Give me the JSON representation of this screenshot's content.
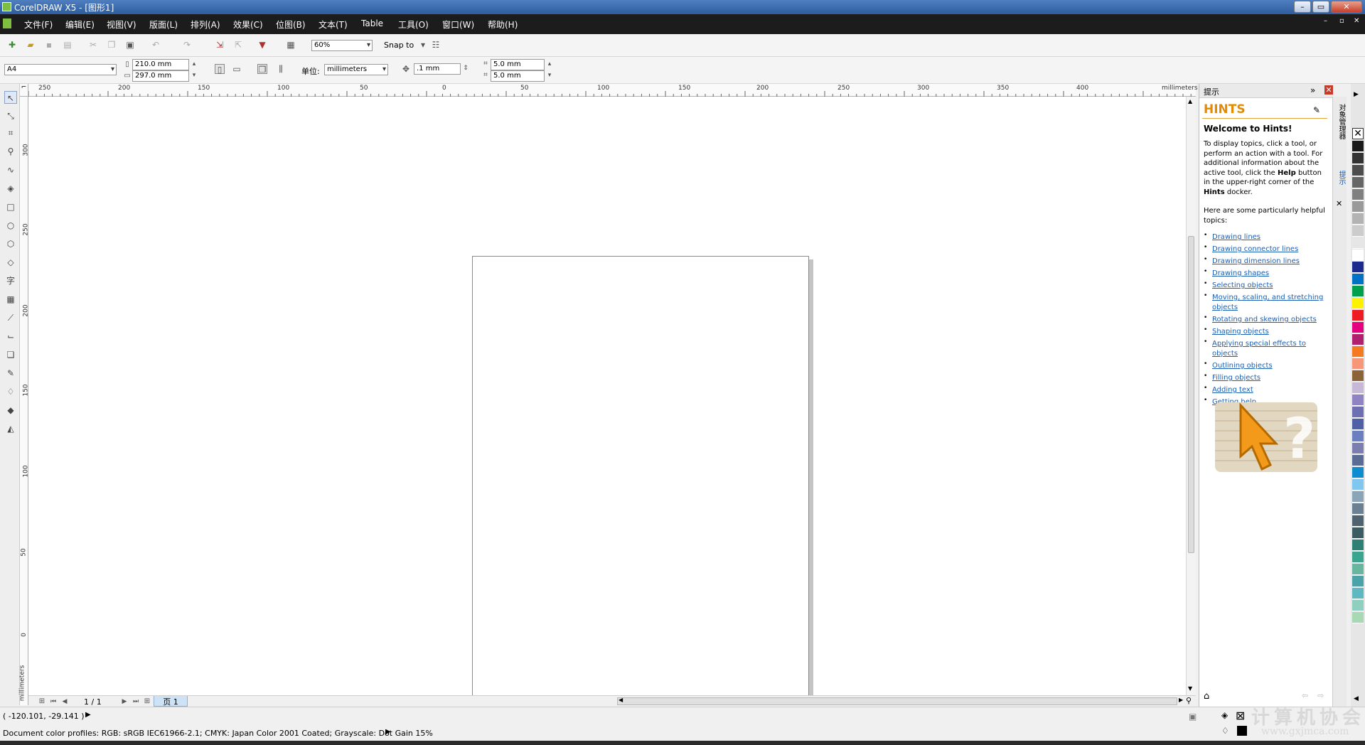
{
  "window": {
    "title": "CorelDRAW X5 - [图形1]",
    "controls": {
      "minimize": "–",
      "restore": "▭",
      "close": "✕"
    }
  },
  "menu": [
    "文件(F)",
    "编辑(E)",
    "视图(V)",
    "版面(L)",
    "排列(A)",
    "效果(C)",
    "位图(B)",
    "文本(T)",
    "Table",
    "工具(O)",
    "窗口(W)",
    "帮助(H)"
  ],
  "standard_toolbar": {
    "zoom_value": "60%",
    "snap_label": "Snap to"
  },
  "property_bar": {
    "paper_size": "A4",
    "width": "210.0 mm",
    "height": "297.0 mm",
    "units_label": "单位:",
    "units_value": "millimeters",
    "nudge": ".1 mm",
    "dup_x": "5.0 mm",
    "dup_y": "5.0 mm"
  },
  "ruler": {
    "unit": "millimeters",
    "h_ticks": [
      "250",
      "200",
      "150",
      "100",
      "50",
      "0",
      "50",
      "100",
      "150",
      "200",
      "250",
      "300",
      "350",
      "400"
    ],
    "v_ticks": [
      "300",
      "250",
      "200",
      "150",
      "100",
      "50",
      "0"
    ],
    "v_unit": "millimeters"
  },
  "page_nav": {
    "counter": "1 / 1",
    "tab_label": "页 1"
  },
  "docker": {
    "panel_title": "提示",
    "heading": "HINTS",
    "welcome": "Welcome to Hints!",
    "intro_1": "To display topics, click a tool, or perform an action with a tool. For additional information about the active tool, click the",
    "intro_help": "Help",
    "intro_2": "button in the upper-right corner of the",
    "intro_hints": "Hints",
    "intro_3": "docker.",
    "helpful": "Here are some particularly helpful topics:",
    "links": [
      "Drawing lines",
      "Drawing connector lines",
      "Drawing dimension lines",
      "Drawing shapes",
      "Selecting objects",
      "Moving, scaling, and stretching objects",
      "Rotating and skewing objects",
      "Shaping objects",
      "Applying special effects to objects",
      "Outlining objects",
      "Filling objects",
      "Adding text",
      "Getting help"
    ]
  },
  "docker_tabs": [
    "对象管理器",
    "提示"
  ],
  "palette_colors": [
    "#1a1a1a",
    "#333333",
    "#4d4d4d",
    "#666666",
    "#808080",
    "#999999",
    "#b3b3b3",
    "#cccccc",
    "#e6e6e6",
    "#ffffff",
    "#1b2a8c",
    "#0072c6",
    "#00a04a",
    "#fff200",
    "#ed1c24",
    "#e4007f",
    "#b0206e",
    "#f47920",
    "#f7977a",
    "#8c6239",
    "#c7b8d8",
    "#8f83c4",
    "#6d6fb3",
    "#4f5fa8",
    "#6a7fc0",
    "#7c7eb0",
    "#5b6c94",
    "#0f8ccf",
    "#7fc7ef",
    "#8ba5b8",
    "#6b8090",
    "#4e6270",
    "#3c5c63",
    "#2e7f74",
    "#3aa58f",
    "#69b6a0",
    "#4aa3a8",
    "#5db8c1",
    "#8fcfbf",
    "#a7d9b5"
  ],
  "status": {
    "coords": "( -120.101, -29.141 )",
    "profiles": "Document color profiles: RGB: sRGB IEC61966-2.1; CMYK: Japan Color 2001 Coated; Grayscale: Dot Gain 15%"
  },
  "watermark": {
    "text": "计算机协会",
    "url": "www.gxjmca.com"
  }
}
